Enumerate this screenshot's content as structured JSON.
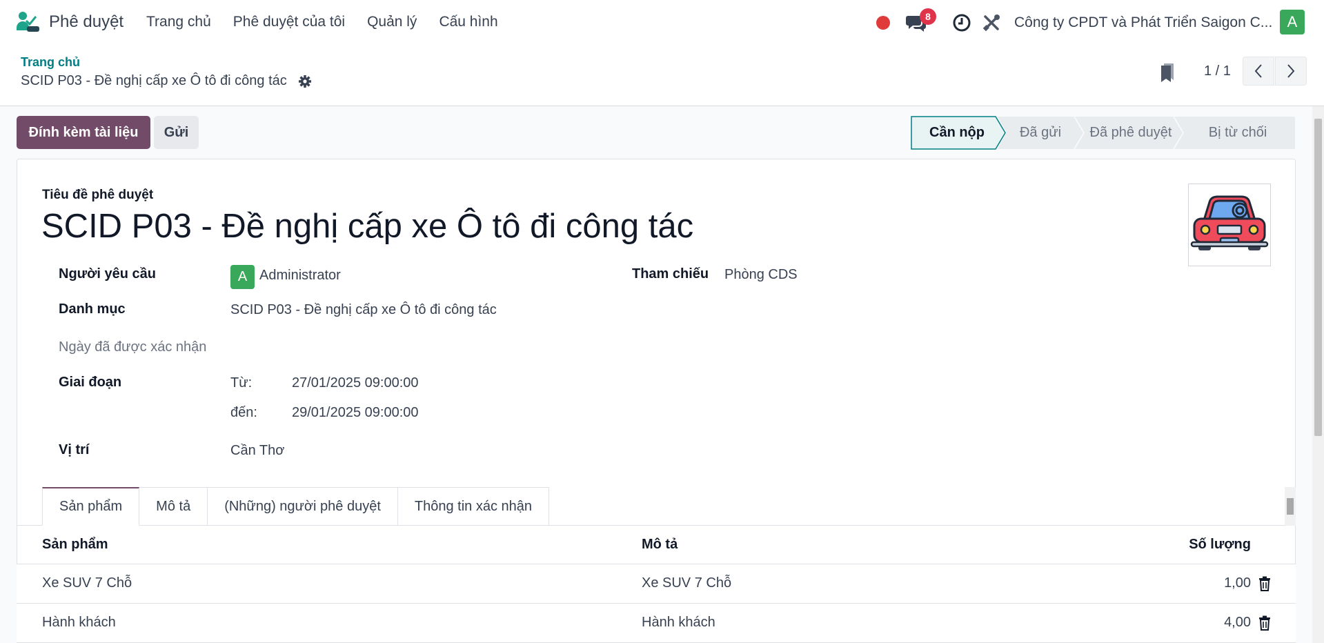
{
  "navbar": {
    "app_name": "Phê duyệt",
    "menu": [
      "Trang chủ",
      "Phê duyệt của tôi",
      "Quản lý",
      "Cấu hình"
    ],
    "notification_count": "8",
    "company": "Công ty CPDT và Phát Triển Saigon C...",
    "user_initial": "A",
    "icons": [
      "record-dot",
      "chat-icon",
      "clock-icon",
      "tools-icon"
    ]
  },
  "breadcrumb": {
    "root": "Trang chủ",
    "current": "SCID P03 - Đề nghị cấp xe Ô tô đi công tác"
  },
  "pager": {
    "value": "1 / 1"
  },
  "actions": {
    "attach_label": "Đính kèm tài liệu",
    "send_label": "Gửi"
  },
  "statusbar": {
    "steps": [
      "Cần nộp",
      "Đã gửi",
      "Đã phê duyệt",
      "Bị từ chối"
    ],
    "active": "Cần nộp"
  },
  "form": {
    "title_caption": "Tiêu đề phê duyệt",
    "title": "SCID P03 - Đề nghị cấp xe Ô tô đi công tác",
    "requester_label": "Người yêu cầu",
    "requester_initial": "A",
    "requester": "Administrator",
    "reference_label": "Tham chiếu",
    "reference": "Phòng CDS",
    "category_label": "Danh mục",
    "category": "SCID P03 - Đề nghị cấp xe Ô tô đi công tác",
    "confirmed_date_label": "Ngày đã được xác nhận",
    "period_label": "Giai đoạn",
    "from_label": "Từ:",
    "from_value": "27/01/2025 09:00:00",
    "to_label": "đến:",
    "to_value": "29/01/2025 09:00:00",
    "location_label": "Vị trí",
    "location": "Cần Thơ"
  },
  "tabs": [
    "Sản phẩm",
    "Mô tả",
    "(Những) người phê duyệt",
    "Thông tin xác nhận"
  ],
  "product_table": {
    "headers": [
      "Sản phẩm",
      "Mô tả",
      "Số lượng"
    ],
    "rows": [
      {
        "product": "Xe SUV 7 Chỗ",
        "description": "Xe SUV 7 Chỗ",
        "quantity": "1,00"
      },
      {
        "product": "Hành khách",
        "description": "Hành khách",
        "quantity": "4,00"
      }
    ]
  },
  "colors": {
    "brand": "#714b67",
    "link": "#017e84",
    "avatar": "#3aa85a",
    "badge": "#e0344a"
  }
}
